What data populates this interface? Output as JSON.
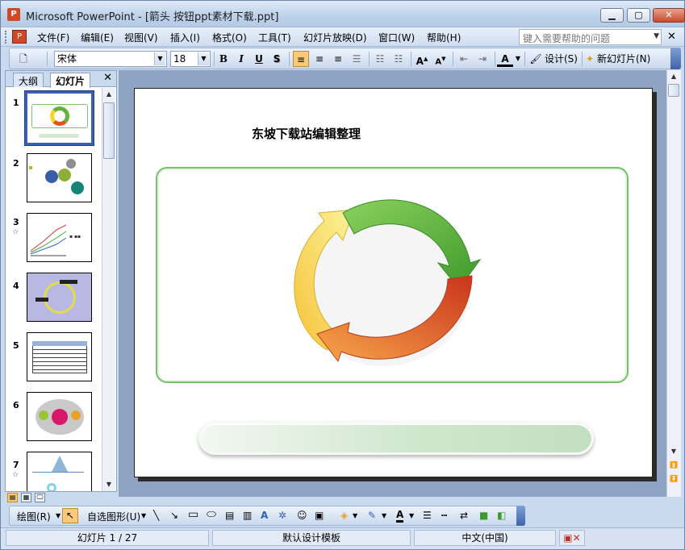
{
  "window": {
    "app_icon": "P",
    "title": "Microsoft PowerPoint - [箭头 按钮ppt素材下载.ppt]",
    "controls": [
      "minimize",
      "maximize",
      "close"
    ]
  },
  "menu": {
    "items": [
      "文件(F)",
      "编辑(E)",
      "视图(V)",
      "插入(I)",
      "格式(O)",
      "工具(T)",
      "幻灯片放映(D)",
      "窗口(W)",
      "帮助(H)"
    ],
    "help_placeholder": "键入需要帮助的问题"
  },
  "format_toolbar": {
    "font": "宋体",
    "size": "18",
    "bold": "B",
    "italic": "I",
    "underline": "U",
    "shadow": "S",
    "design_label": "设计(S)",
    "new_slide_label": "新幻灯片(N)"
  },
  "left_pane": {
    "tabs": [
      "大纲",
      "幻灯片"
    ],
    "active_tab": "幻灯片",
    "slide_numbers": [
      "1",
      "2",
      "3",
      "4",
      "5",
      "6",
      "7"
    ],
    "selected_slide": 1
  },
  "slide": {
    "title": "东坡下载站编辑整理",
    "cycle_colors": [
      "#5fb43a",
      "#e5541c",
      "#f3d52b"
    ]
  },
  "draw_toolbar": {
    "draw_label": "绘图(R)",
    "autoshapes_label": "自选图形(U)"
  },
  "status": {
    "slide_info": "幻灯片 1 / 27",
    "template": "默认设计模板",
    "language": "中文(中国)"
  }
}
